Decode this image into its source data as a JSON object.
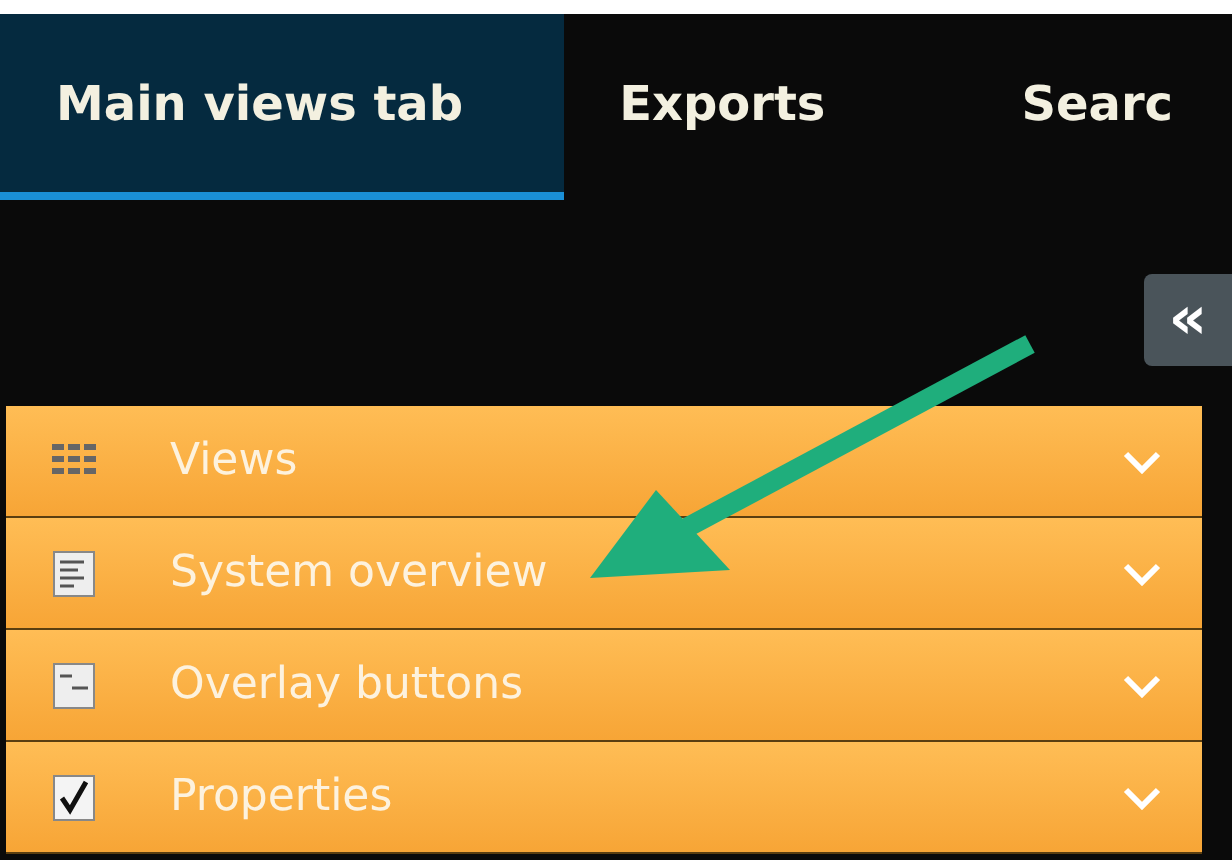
{
  "tabs": [
    {
      "label": "Main views tab",
      "selected": true
    },
    {
      "label": "Exports",
      "selected": false
    },
    {
      "label": "Searc",
      "selected": false
    }
  ],
  "collapse_button": {
    "label": "«"
  },
  "panels": [
    {
      "label": "Views",
      "kind": "grid"
    },
    {
      "label": "System overview",
      "kind": "list"
    },
    {
      "label": "Overlay buttons",
      "kind": "overlay"
    },
    {
      "label": "Properties",
      "kind": "check"
    }
  ]
}
